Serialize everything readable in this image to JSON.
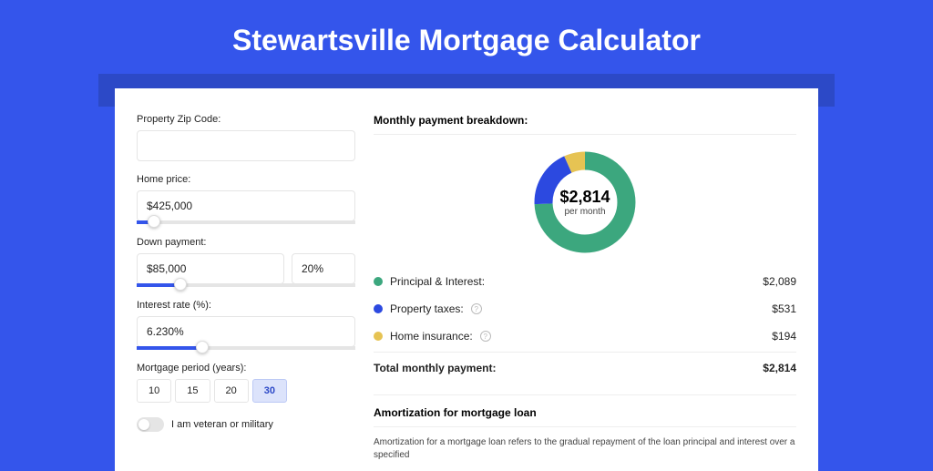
{
  "page_title": "Stewartsville Mortgage Calculator",
  "form": {
    "zip_label": "Property Zip Code:",
    "zip_value": "",
    "price_label": "Home price:",
    "price_value": "$425,000",
    "down_label": "Down payment:",
    "down_amount": "$85,000",
    "down_pct": "20%",
    "rate_label": "Interest rate (%):",
    "rate_value": "6.230%",
    "period_label": "Mortgage period (years):",
    "period_options": [
      "10",
      "15",
      "20",
      "30"
    ],
    "period_selected": "30",
    "veteran_label": "I am veteran or military"
  },
  "breakdown": {
    "title": "Monthly payment breakdown:",
    "center_value": "$2,814",
    "center_sub": "per month",
    "rows": [
      {
        "label": "Principal & Interest:",
        "value": "$2,089",
        "color": "#3ca77e",
        "info": false
      },
      {
        "label": "Property taxes:",
        "value": "$531",
        "color": "#2c49e0",
        "info": true
      },
      {
        "label": "Home insurance:",
        "value": "$194",
        "color": "#e6c353",
        "info": true
      }
    ],
    "total_label": "Total monthly payment:",
    "total_value": "$2,814"
  },
  "amort": {
    "title": "Amortization for mortgage loan",
    "text": "Amortization for a mortgage loan refers to the gradual repayment of the loan principal and interest over a specified"
  },
  "chart_data": {
    "type": "pie",
    "title": "Monthly payment breakdown",
    "series": [
      {
        "name": "Principal & Interest",
        "value": 2089,
        "color": "#3ca77e"
      },
      {
        "name": "Property taxes",
        "value": 531,
        "color": "#2c49e0"
      },
      {
        "name": "Home insurance",
        "value": 194,
        "color": "#e6c353"
      }
    ],
    "total": 2814
  },
  "sliders": {
    "price_pct": 8,
    "down_pct": 20,
    "rate_pct": 30
  }
}
